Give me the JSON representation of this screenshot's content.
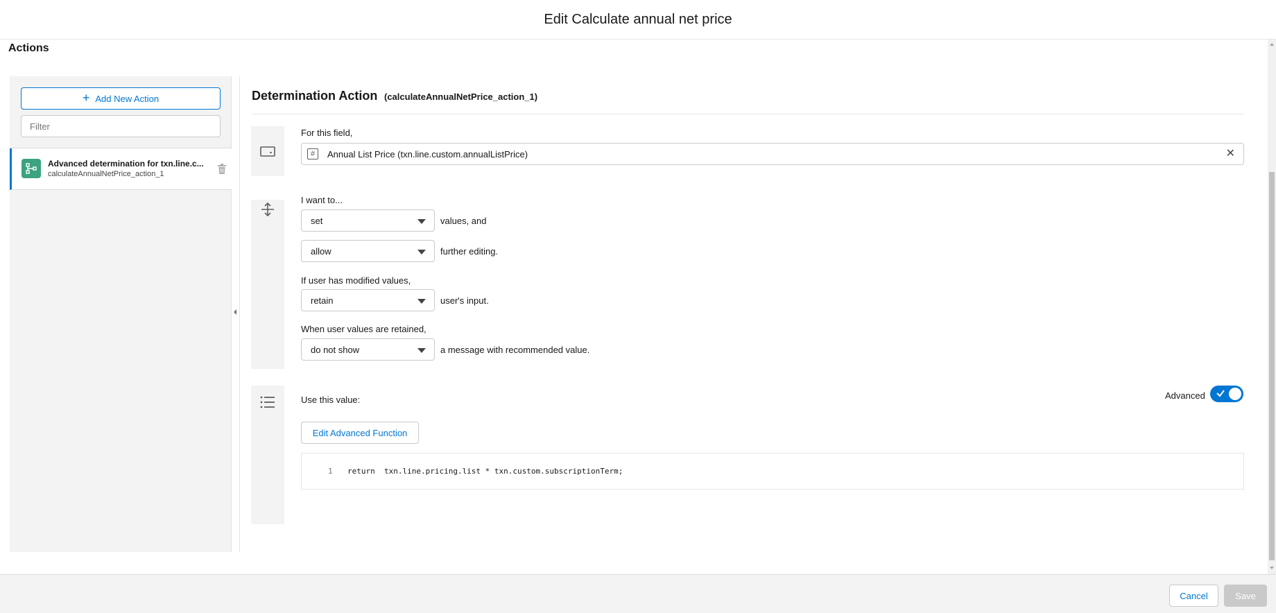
{
  "modal": {
    "title": "Edit Calculate annual net price"
  },
  "section_title": "Actions",
  "left_panel": {
    "add_button_label": "Add New Action",
    "filter_placeholder": "Filter",
    "actions": [
      {
        "name": "Advanced determination for txn.line.c...",
        "subtitle": "calculateAnnualNetPrice_action_1",
        "icon": "flow-icon",
        "selected": true
      }
    ]
  },
  "detail": {
    "title": "Determination Action",
    "subtitle": "(calculateAnnualNetPrice_action_1)",
    "field_section": {
      "icon": "field-icon",
      "label": "For this field,",
      "value": "Annual List Price (txn.line.custom.annualListPrice)",
      "type_icon": "#",
      "clear_icon": "close-icon"
    },
    "behavior_section": {
      "icon": "direction-icon",
      "intro_label": "I want to...",
      "mode_select": "set",
      "mode_suffix": "values, and",
      "editing_select": "allow",
      "editing_suffix": "further editing.",
      "modified_label": "If user has modified values,",
      "modified_select": "retain",
      "modified_suffix": "user's input.",
      "retained_label": "When user values are retained,",
      "retained_select": "do not show",
      "retained_suffix": "a message with recommended value."
    },
    "value_section": {
      "icon": "list-icon",
      "label": "Use this value:",
      "advanced_label": "Advanced",
      "advanced_enabled": true,
      "edit_button_label": "Edit Advanced Function",
      "code_line_number": "1",
      "code": "return  txn.line.pricing.list * txn.custom.subscriptionTerm;"
    }
  },
  "footer": {
    "cancel_label": "Cancel",
    "save_label": "Save"
  },
  "colors": {
    "brand": "#0176d3",
    "action_icon_bg": "#3ba380",
    "panel_bg": "#f3f3f3",
    "disabled": "#c9c9c9"
  }
}
